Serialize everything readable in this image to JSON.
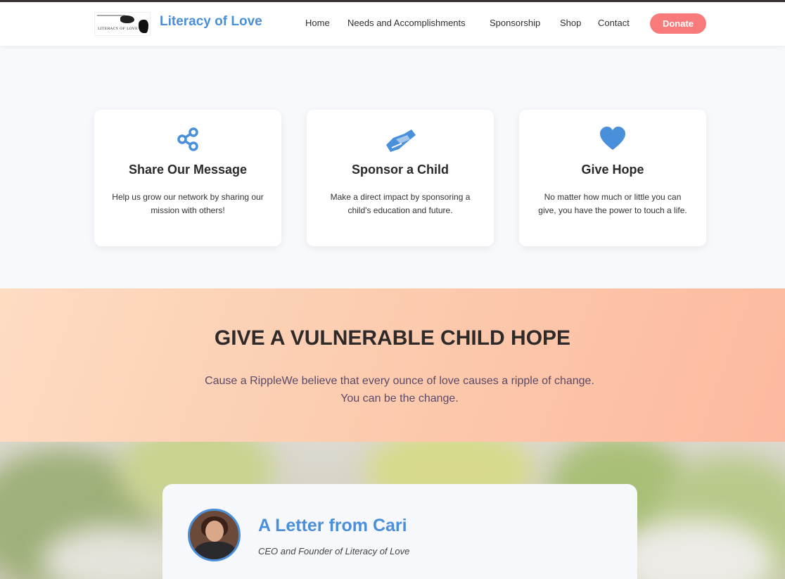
{
  "header": {
    "logo_text": "LITERACY OF LOVE",
    "brand": "Literacy of Love",
    "nav": [
      "Home",
      "Needs and Accomplishments",
      "Sponsorship",
      "Shop",
      "Contact"
    ],
    "donate_label": "Donate"
  },
  "cards": [
    {
      "icon": "share-icon",
      "title": "Share Our Message",
      "text": "Help us grow our network by sharing our mission with others!"
    },
    {
      "icon": "handshake-icon",
      "title": "Sponsor a Child",
      "text": "Make a direct impact by sponsoring a child's education and future."
    },
    {
      "icon": "heart-icon",
      "title": "Give Hope",
      "text": "No matter how much or little you can give, you have the power to touch a life."
    }
  ],
  "hope": {
    "heading": "GIVE A VULNERABLE CHILD HOPE",
    "text": "Cause a RippleWe believe that every ounce of love causes a ripple of change. You can be the change."
  },
  "letter": {
    "title": "A Letter from Cari",
    "subtitle": "CEO and Founder of Literacy of Love"
  },
  "colors": {
    "accent": "#4a8fd9",
    "donate": "#f87a7a"
  }
}
